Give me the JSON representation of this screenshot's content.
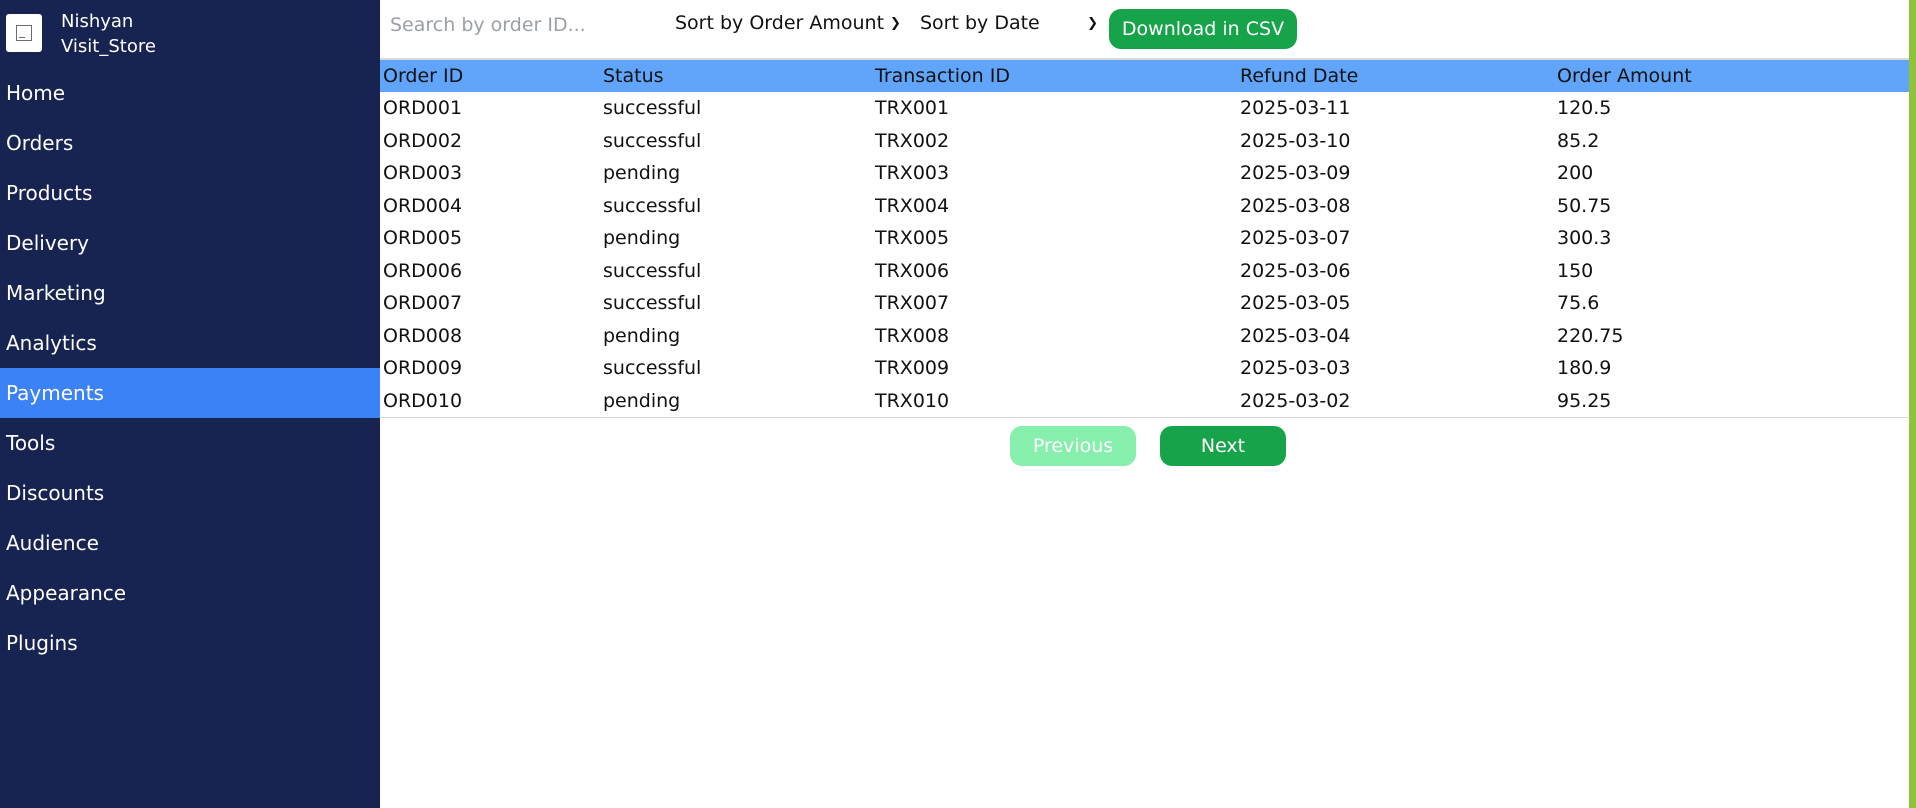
{
  "sidebar": {
    "store_name": "Nishyan",
    "store_link": "Visit_Store",
    "items": [
      {
        "label": "Home"
      },
      {
        "label": "Orders"
      },
      {
        "label": "Products"
      },
      {
        "label": "Delivery"
      },
      {
        "label": "Marketing"
      },
      {
        "label": "Analytics"
      },
      {
        "label": "Payments",
        "active": true
      },
      {
        "label": "Tools"
      },
      {
        "label": "Discounts"
      },
      {
        "label": "Audience"
      },
      {
        "label": "Appearance"
      },
      {
        "label": "Plugins"
      }
    ]
  },
  "toolbar": {
    "search_placeholder": "Search by order ID...",
    "search_value": "",
    "sort_amount_label": "Sort by Order Amount",
    "sort_date_label": "Sort by Date",
    "csv_label": "Download in CSV"
  },
  "table": {
    "headers": [
      "Order ID",
      "Status",
      "Transaction ID",
      "Refund Date",
      "Order Amount"
    ],
    "rows": [
      [
        "ORD001",
        "successful",
        "TRX001",
        "2025-03-11",
        "120.5"
      ],
      [
        "ORD002",
        "successful",
        "TRX002",
        "2025-03-10",
        "85.2"
      ],
      [
        "ORD003",
        "pending",
        "TRX003",
        "2025-03-09",
        "200"
      ],
      [
        "ORD004",
        "successful",
        "TRX004",
        "2025-03-08",
        "50.75"
      ],
      [
        "ORD005",
        "pending",
        "TRX005",
        "2025-03-07",
        "300.3"
      ],
      [
        "ORD006",
        "successful",
        "TRX006",
        "2025-03-06",
        "150"
      ],
      [
        "ORD007",
        "successful",
        "TRX007",
        "2025-03-05",
        "75.6"
      ],
      [
        "ORD008",
        "pending",
        "TRX008",
        "2025-03-04",
        "220.75"
      ],
      [
        "ORD009",
        "successful",
        "TRX009",
        "2025-03-03",
        "180.9"
      ],
      [
        "ORD010",
        "pending",
        "TRX010",
        "2025-03-02",
        "95.25"
      ]
    ]
  },
  "pagination": {
    "previous_label": "Previous",
    "next_label": "Next"
  },
  "colors": {
    "sidebar_bg": "#172350",
    "active_nav": "#3b82f6",
    "table_header": "#60a5fa",
    "primary_button": "#16a34a",
    "disabled_button": "#86efac"
  }
}
